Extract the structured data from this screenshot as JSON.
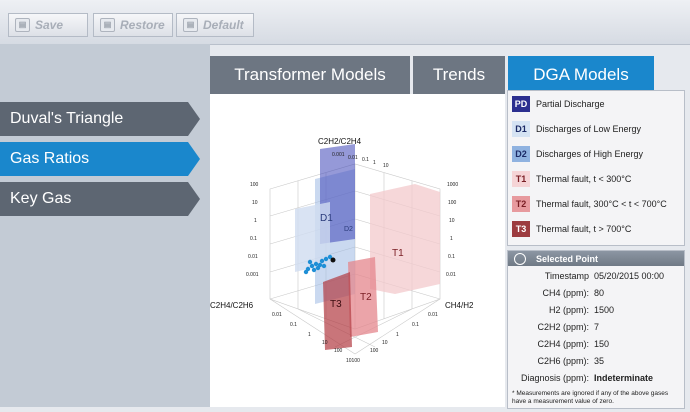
{
  "toolbar": {
    "buttons": [
      {
        "label": "Save",
        "icon": "save-icon"
      },
      {
        "label": "Restore",
        "icon": "restore-icon"
      },
      {
        "label": "Default",
        "icon": "default-icon"
      }
    ]
  },
  "tabs": [
    {
      "label": "Transformer Models",
      "active": false
    },
    {
      "label": "Trends",
      "active": false
    },
    {
      "label": "DGA Models",
      "active": true
    }
  ],
  "sidebar": {
    "items": [
      {
        "label": "Duval's Triangle",
        "active": false
      },
      {
        "label": "Gas Ratios",
        "active": true
      },
      {
        "label": "Key Gas",
        "active": false
      }
    ]
  },
  "plot": {
    "axis_top": "C2H2/C2H4",
    "axis_left": "C2H4/C2H6",
    "axis_right": "CH4/H2",
    "zone_labels": [
      "D1",
      "D2",
      "T1",
      "T2",
      "T3"
    ],
    "tick_labels": {
      "top": [
        "0.001",
        "0.01",
        "0.1",
        "1",
        "10"
      ],
      "left_upper": [
        "100",
        "10",
        "1",
        "0.1",
        "0.01",
        "0.001"
      ],
      "center_scale": [
        "1000",
        "100",
        "10",
        "1",
        "0.1",
        "0.01"
      ],
      "bottom_left": [
        "0.01",
        "0.1",
        "1",
        "10",
        "100"
      ],
      "bottom_right": [
        "0.01",
        "0.1",
        "1",
        "10",
        "100"
      ],
      "bottom": "10100"
    }
  },
  "legend": [
    {
      "code": "PD",
      "label": "Partial Discharge",
      "color": "#2c2f8f",
      "text_color": "#ffffff"
    },
    {
      "code": "D1",
      "label": "Discharges of Low Energy",
      "color": "#d5e3f3",
      "text_color": "#1c2a66"
    },
    {
      "code": "D2",
      "label": "Discharges of High Energy",
      "color": "#8fb2e0",
      "text_color": "#1c2a66"
    },
    {
      "code": "T1",
      "label": "Thermal fault, t < 300°C",
      "color": "#f5d4d6",
      "text_color": "#7a1e24"
    },
    {
      "code": "T2",
      "label": "Thermal fault, 300°C < t < 700°C",
      "color": "#e79a9e",
      "text_color": "#7a1e24"
    },
    {
      "code": "T3",
      "label": "Thermal fault, t > 700°C",
      "color": "#9c3b3f",
      "text_color": "#ffffff"
    }
  ],
  "selected_point": {
    "title": "Selected Point",
    "rows": [
      {
        "label": "Timestamp",
        "value": "05/20/2015 00:00"
      },
      {
        "label": "CH4 (ppm):",
        "value": "80"
      },
      {
        "label": "H2 (ppm):",
        "value": "1500"
      },
      {
        "label": "C2H2 (ppm):",
        "value": "7"
      },
      {
        "label": "C2H4 (ppm):",
        "value": "150"
      },
      {
        "label": "C2H6 (ppm):",
        "value": "35"
      },
      {
        "label": "Diagnosis (ppm):",
        "value": "Indeterminate"
      }
    ],
    "note": "* Measurements are ignored if any of the above gases have a measurement value of zero."
  },
  "colors": {
    "accent": "#1a87cc",
    "tab_inactive": "#6d7682",
    "nav_inactive": "#5d6672"
  }
}
